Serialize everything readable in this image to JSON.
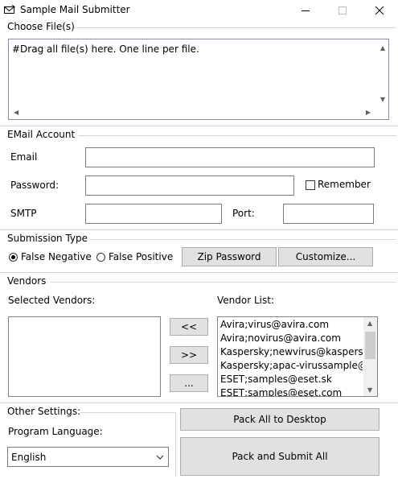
{
  "window": {
    "title": "Sample Mail Submitter"
  },
  "files": {
    "group_label": "Choose File(s)",
    "text": "#Drag all file(s) here. One line per file."
  },
  "account": {
    "group_label": "EMail Account",
    "email_label": "Email",
    "email_value": "",
    "password_label": "Password:",
    "password_value": "",
    "remember_label": "Remember",
    "remember_checked": false,
    "smtp_label": "SMTP",
    "smtp_value": "",
    "port_label": "Port:",
    "port_value": ""
  },
  "submission": {
    "group_label": "Submission Type",
    "false_negative_label": "False Negative",
    "false_positive_label": "False Positive",
    "selected": "False Negative",
    "zip_password_button": "Zip Password",
    "customize_button": "Customize..."
  },
  "vendors": {
    "group_label": "Vendors",
    "selected_label": "Selected Vendors:",
    "selected_items": [],
    "add_button": "<<",
    "remove_button": ">>",
    "more_button": "...",
    "list_label": "Vendor List:",
    "list_items": [
      "Avira;virus@avira.com",
      "Avira;novirus@avira.com",
      "Kaspersky;newvirus@kaspersky",
      "Kaspersky;apac-virussample@",
      "ESET;samples@eset.sk",
      "ESET;samples@eset.com"
    ]
  },
  "other": {
    "group_label": "Other Settings:",
    "language_label": "Program Language:",
    "language_value": "English",
    "pack_desktop_button": "Pack All to Desktop",
    "pack_submit_button": "Pack and Submit All"
  }
}
